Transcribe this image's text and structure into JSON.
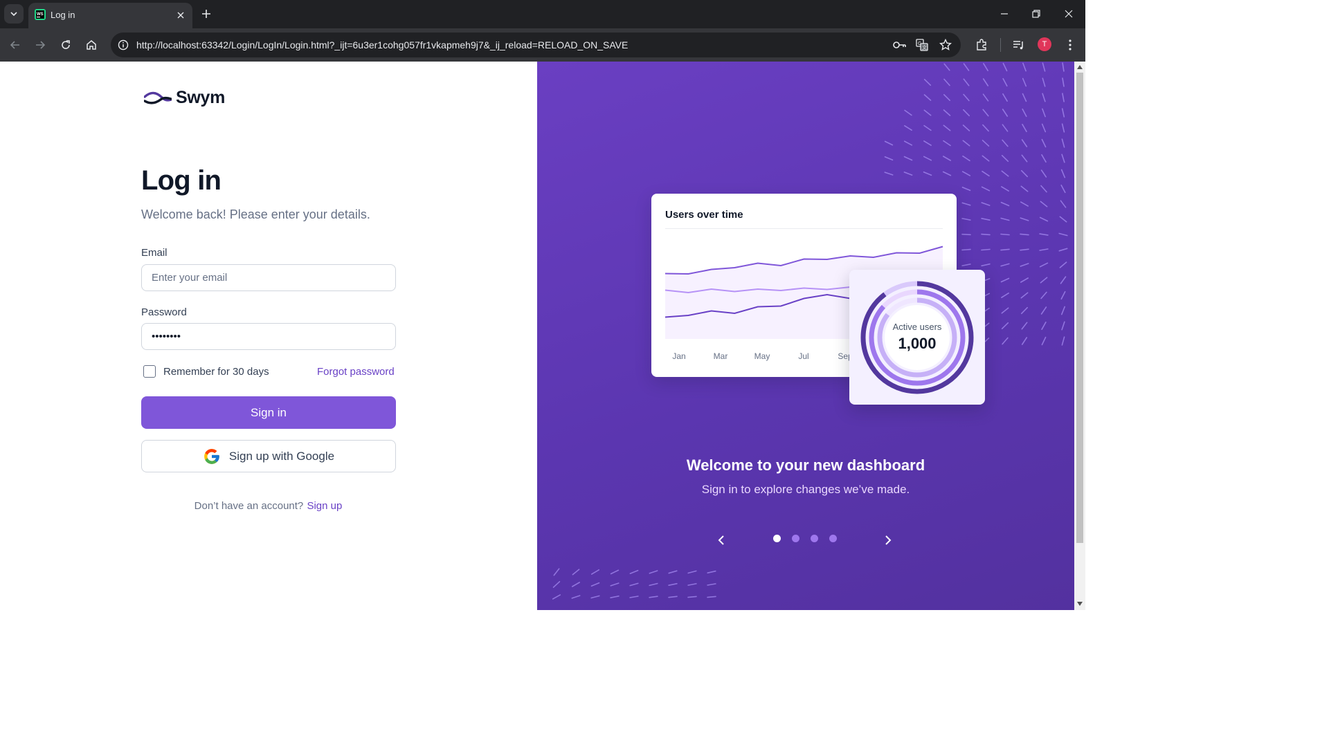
{
  "browser": {
    "tab_title": "Log in",
    "url": "http://localhost:63342/Login/LogIn/Login.html?_ijt=6u3er1cohg057fr1vkapmeh9j7&_ij_reload=RELOAD_ON_SAVE",
    "profile_initial": "T"
  },
  "brand": {
    "name": "Swym"
  },
  "form": {
    "heading": "Log in",
    "subheading": "Welcome back! Please enter your details.",
    "email_label": "Email",
    "email_placeholder": "Enter your email",
    "email_value": "",
    "password_label": "Password",
    "password_value": "••••••••",
    "remember_label": "Remember for 30 days",
    "remember_checked": false,
    "forgot_label": "Forgot password",
    "sign_in_label": "Sign in",
    "google_label": "Sign up with Google",
    "no_account_text": "Don’t have an account?",
    "sign_up_label": "Sign up"
  },
  "promo": {
    "chart_title": "Users over time",
    "donut_label": "Active users",
    "donut_value": "1,000",
    "title": "Welcome to your new dashboard",
    "subtitle": "Sign in to explore changes we’ve made.",
    "slide_count": 4,
    "active_slide": 1
  },
  "chart_data": {
    "type": "line",
    "title": "Users over time",
    "categories": [
      "Jan",
      "Mar",
      "May",
      "Jul",
      "Sep"
    ],
    "series": [
      {
        "values": [
          62,
          64,
          66,
          70,
          72,
          72,
          76,
          78,
          79,
          80,
          82,
          84,
          88
        ]
      },
      {
        "values": [
          46,
          46,
          47,
          47,
          47,
          48,
          48,
          49,
          49,
          48,
          50,
          51,
          52
        ]
      },
      {
        "values": [
          20,
          24,
          26,
          26,
          30,
          33,
          38,
          44,
          38,
          48,
          52,
          56,
          60
        ]
      }
    ],
    "colors": {
      "line_dark": "#6941c6",
      "line_mid": "#7f56d9",
      "line_light": "#b692f6"
    }
  },
  "colors": {
    "accent": "#7f56d9",
    "link": "#6941c6",
    "panel_bg": "#5b36b0"
  }
}
